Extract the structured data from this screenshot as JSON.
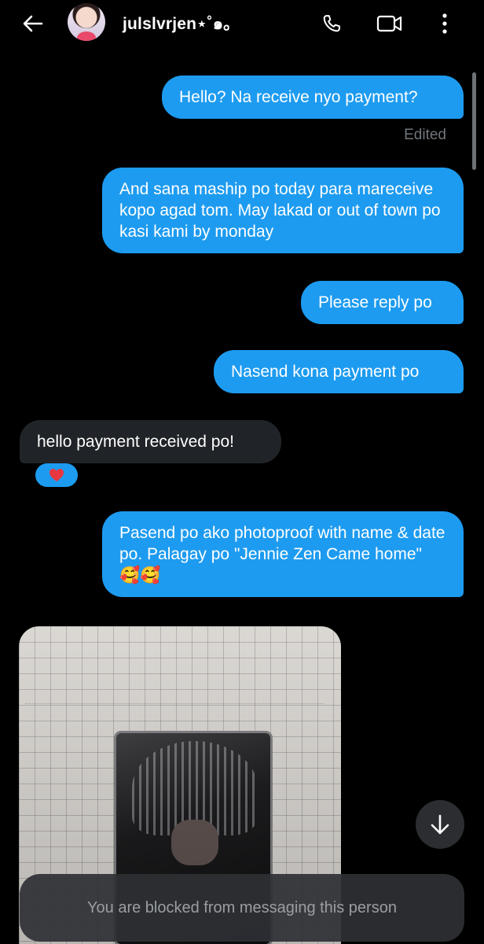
{
  "header": {
    "username": "julslvrjen⋆˚๑｡"
  },
  "messages": [
    {
      "id": "m1",
      "from": "me",
      "text": "Hello? Na receive nyo payment?",
      "status": "Edited"
    },
    {
      "id": "m2",
      "from": "me",
      "text": "And sana maship po today para mareceive kopo agad tom. May lakad or out of town po kasi kami by monday"
    },
    {
      "id": "m3",
      "from": "me",
      "text": "Please reply po"
    },
    {
      "id": "m4",
      "from": "me",
      "text": "Nasend kona payment po"
    },
    {
      "id": "m5",
      "from": "them",
      "text": "hello payment received po!",
      "reaction": "❤️"
    },
    {
      "id": "m6",
      "from": "me",
      "text": "Pasend po ako photoproof with name & date po. Palagay po \"Jennie Zen Came home\" 🥰🥰"
    },
    {
      "id": "m7",
      "from": "them",
      "type": "photo"
    }
  ],
  "footer": {
    "blocked_text": "You are blocked from messaging this person"
  },
  "icons": {
    "back": "arrow-left-icon",
    "phone": "phone-icon",
    "video": "video-camera-icon",
    "more": "more-vertical-icon",
    "scroll_down": "arrow-down-icon"
  },
  "colors": {
    "background": "#000000",
    "sent_bubble": "#1d9bf0",
    "received_bubble": "#202327",
    "muted_text": "#71767b"
  }
}
